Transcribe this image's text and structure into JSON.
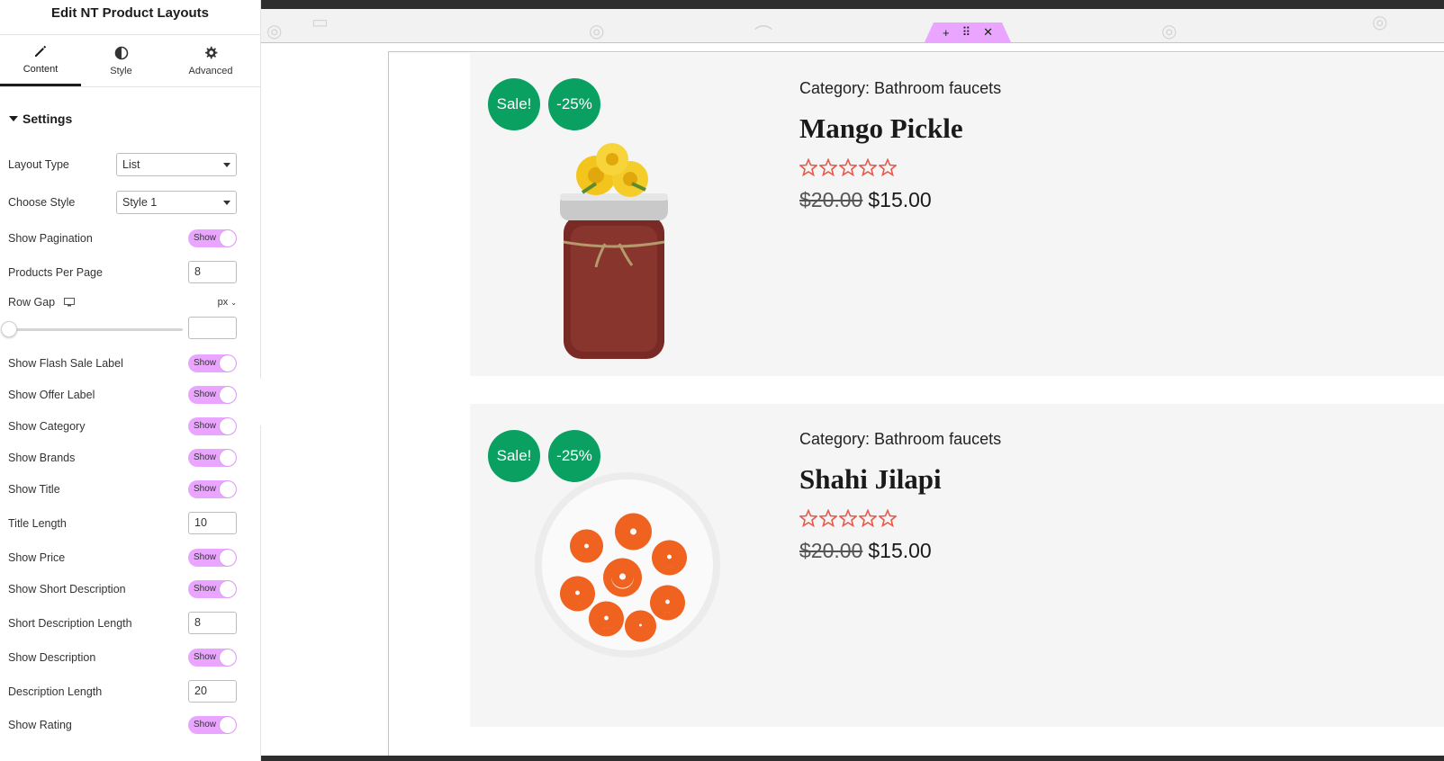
{
  "panel": {
    "title": "Edit NT Product Layouts",
    "tabs": [
      {
        "label": "Content",
        "icon": "pencil-icon"
      },
      {
        "label": "Style",
        "icon": "half-circle-icon"
      },
      {
        "label": "Advanced",
        "icon": "gear-icon"
      }
    ],
    "section": "Settings",
    "layout_type": {
      "label": "Layout Type",
      "value": "List"
    },
    "choose_style": {
      "label": "Choose Style",
      "value": "Style 1"
    },
    "show_pagination": {
      "label": "Show Pagination",
      "value": "Show"
    },
    "products_per_page": {
      "label": "Products Per Page",
      "value": "8"
    },
    "row_gap": {
      "label": "Row Gap",
      "unit": "px",
      "value": ""
    },
    "show_flash_sale": {
      "label": "Show Flash Sale Label",
      "value": "Show"
    },
    "show_offer": {
      "label": "Show Offer Label",
      "value": "Show"
    },
    "show_category": {
      "label": "Show Category",
      "value": "Show"
    },
    "show_brands": {
      "label": "Show Brands",
      "value": "Show"
    },
    "show_title": {
      "label": "Show Title",
      "value": "Show"
    },
    "title_length": {
      "label": "Title Length",
      "value": "10"
    },
    "show_price": {
      "label": "Show Price",
      "value": "Show"
    },
    "show_short_desc": {
      "label": "Show Short Description",
      "value": "Show"
    },
    "short_desc_length": {
      "label": "Short Description Length",
      "value": "8"
    },
    "show_desc": {
      "label": "Show Description",
      "value": "Show"
    },
    "desc_length": {
      "label": "Description Length",
      "value": "20"
    },
    "show_rating": {
      "label": "Show Rating",
      "value": "Show"
    }
  },
  "toolbar": {
    "add": "+",
    "move": "⠿",
    "close": "✕"
  },
  "products": [
    {
      "sale": "Sale!",
      "offer": "-25%",
      "category": "Category: Bathroom faucets",
      "title": "Mango Pickle",
      "old_price": "$20.00",
      "price": "$15.00",
      "rating": 0
    },
    {
      "sale": "Sale!",
      "offer": "-25%",
      "category": "Category: Bathroom faucets",
      "title": "Shahi Jilapi",
      "old_price": "$20.00",
      "price": "$15.00",
      "rating": 0
    }
  ],
  "colors": {
    "accent": "#e9a5ff",
    "badge": "#0aa061",
    "star": "#e8594b"
  }
}
